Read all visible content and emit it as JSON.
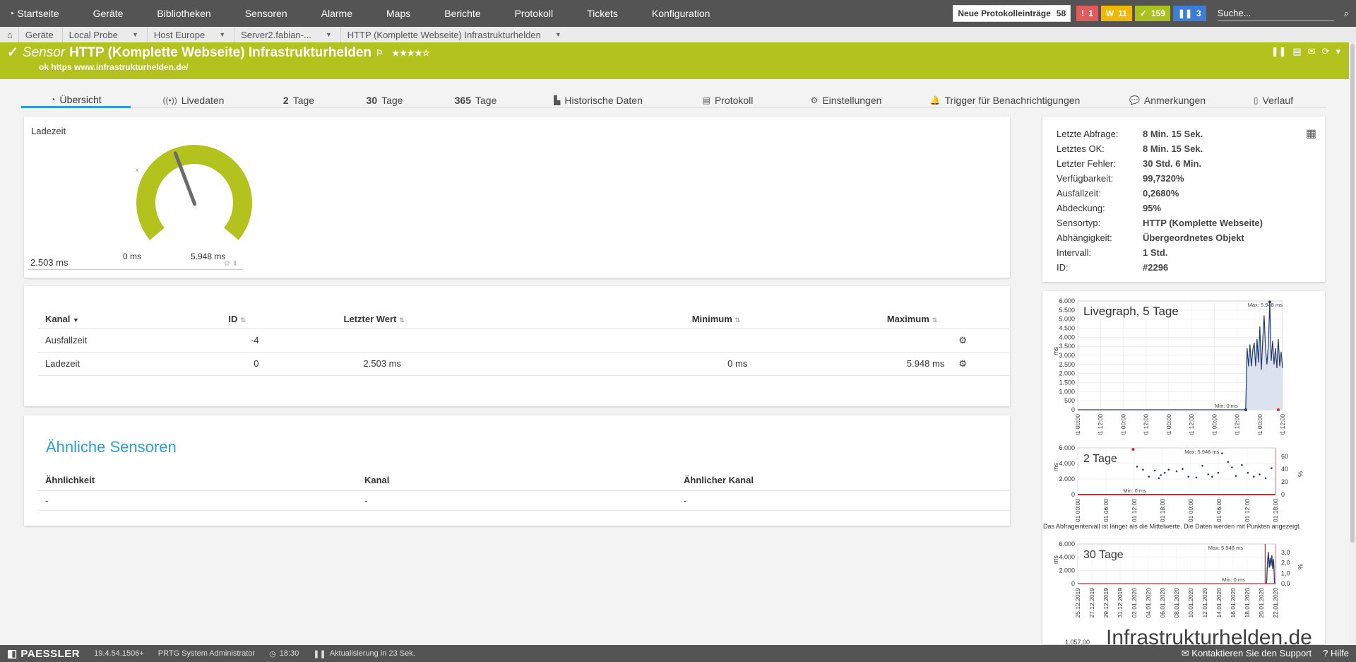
{
  "nav": {
    "home_label": "Startseite",
    "items": [
      "Geräte",
      "Bibliotheken",
      "Sensoren",
      "Alarme",
      "Maps",
      "Berichte",
      "Protokoll",
      "Tickets",
      "Konfiguration"
    ],
    "new_log_label": "Neue Protokolleinträge",
    "new_log_count": "58",
    "badge_red": "1",
    "badge_yellow": "11",
    "badge_green": "159",
    "badge_blue": "3",
    "search_placeholder": "Suche..."
  },
  "breadcrumb": [
    "Geräte",
    "Local Probe",
    "Host Europe",
    "Server2.fabian-...",
    "HTTP (Komplette Webseite) Infrastrukturhelden"
  ],
  "sensor": {
    "prefix": "Sensor",
    "name": "HTTP (Komplette Webseite) Infrastrukturhelden",
    "stars": "★★★★☆",
    "status_text": "ok https www.infrastrukturhelden.de/"
  },
  "tabs": [
    {
      "label": "Übersicht",
      "num": "",
      "icon": "◔"
    },
    {
      "label": "Livedaten",
      "num": "",
      "icon": "((•))"
    },
    {
      "label": "Tage",
      "num": "2",
      "icon": ""
    },
    {
      "label": "Tage",
      "num": "30",
      "icon": ""
    },
    {
      "label": "Tage",
      "num": "365",
      "icon": ""
    },
    {
      "label": "Historische Daten",
      "num": "",
      "icon": "▙"
    },
    {
      "label": "Protokoll",
      "num": "",
      "icon": "▤"
    },
    {
      "label": "Einstellungen",
      "num": "",
      "icon": "⚙"
    },
    {
      "label": "Trigger für Benachrichtigungen",
      "num": "",
      "icon": "🔔"
    },
    {
      "label": "Anmerkungen",
      "num": "",
      "icon": "💬"
    },
    {
      "label": "Verlauf",
      "num": "",
      "icon": "▯"
    }
  ],
  "gauge": {
    "title": "Ladezeit",
    "min_label": "0 ms",
    "max_label": "5.948 ms",
    "current_value": "2.503 ms",
    "level_fraction": 0.42,
    "color": "#b4c21d"
  },
  "channels": {
    "headers": [
      "Kanal",
      "ID",
      "Letzter Wert",
      "Minimum",
      "Maximum"
    ],
    "rows": [
      {
        "kanal": "Ausfallzeit",
        "id": "-4",
        "letzter": "",
        "min": "",
        "max": ""
      },
      {
        "kanal": "Ladezeit",
        "id": "0",
        "letzter": "2.503 ms",
        "min": "0 ms",
        "max": "5.948 ms"
      }
    ]
  },
  "similar": {
    "title": "Ähnliche Sensoren",
    "headers": [
      "Ähnlichkeit",
      "Kanal",
      "Ähnlicher Kanal"
    ],
    "row": [
      "-",
      "-",
      "-"
    ]
  },
  "info": [
    {
      "k": "Letzte Abfrage:",
      "v": "8 Min. 15 Sek."
    },
    {
      "k": "Letztes OK:",
      "v": "8 Min. 15 Sek."
    },
    {
      "k": "Letzter Fehler:",
      "v": "30 Std. 6 Min."
    },
    {
      "k": "Verfügbarkeit:",
      "v": "99,7320%"
    },
    {
      "k": "Ausfallzeit:",
      "v": "0,2680%"
    },
    {
      "k": "Abdeckung:",
      "v": "95%"
    },
    {
      "k": "Sensortyp:",
      "v": "HTTP (Komplette Webseite)"
    },
    {
      "k": "Abhängigkeit:",
      "v": "Übergeordnetes Objekt"
    },
    {
      "k": "Intervall:",
      "v": "1 Std."
    },
    {
      "k": "ID:",
      "v": "#2296"
    }
  ],
  "graphs": {
    "live": {
      "title": "Livegraph, 5 Tage",
      "y_unit": "ms",
      "y_ticks": [
        "6.000",
        "5.500",
        "5.000",
        "4.500",
        "4.000",
        "3.500",
        "3.000",
        "2.500",
        "2.000",
        "1.500",
        "1.000",
        "500",
        "0"
      ],
      "x_ticks": [
        "18.01 00:00",
        "18.01 12:00",
        "19.01 00:00",
        "19.01 12:00",
        "20.01 00:00",
        "20.01 12:00",
        "21.01 00:00",
        "21.01 12:00",
        "22.01 00:00",
        "22.01 12:00"
      ],
      "max_label": "Max: 5.948 ms",
      "min_label": "Min: 0 ms"
    },
    "two_days": {
      "title": "2 Tage",
      "y_unit": "ms",
      "y_ticks": [
        "6.000",
        "4.000",
        "2.000",
        "0"
      ],
      "y2_unit": "%",
      "y2_ticks": [
        "60",
        "40",
        "20",
        "0"
      ],
      "x_ticks": [
        "21.01 00:00",
        "21.01 06:00",
        "21.01 12:00",
        "21.01 18:00",
        "22.01 00:00",
        "22.01 06:00",
        "22.01 12:00",
        "22.01 18:00"
      ],
      "max_label": "Max: 5.948 ms",
      "min_label": "Min: 0 ms",
      "note": "Das Abfrageintervall ist länger als die Mittelwerte. Die Daten werden mit Punkten angezeigt."
    },
    "thirty_days": {
      "title": "30 Tage",
      "y_unit": "ms",
      "y_ticks": [
        "6.000",
        "4.000",
        "2.000",
        "0"
      ],
      "y2_unit": "%",
      "y2_ticks": [
        "3,0",
        "2,0",
        "1,0",
        "0,0"
      ],
      "x_ticks": [
        "25.12.2019",
        "27.12.2019",
        "29.12.2019",
        "31.12.2019",
        "02.01.2020",
        "04.01.2020",
        "06.01.2020",
        "08.01.2020",
        "10.01.2020",
        "12.01.2020",
        "14.01.2020",
        "16.01.2020",
        "18.01.2020",
        "20.01.2020",
        "22.01.2020"
      ],
      "max_label": "Max: 5.948 ms",
      "min_label": "Min: 0 ms"
    },
    "year_partial_tick": "1.057,00"
  },
  "footer": {
    "brand": "PAESSLER",
    "version": "19.4.54.1506+",
    "user": "PRTG System Administrator",
    "time": "18:30",
    "refresh": "Aktualisierung in 23 Sek.",
    "support": "Kontaktieren Sie den Support",
    "help": "Hilfe"
  },
  "watermark": "Infrastrukturhelden.de"
}
